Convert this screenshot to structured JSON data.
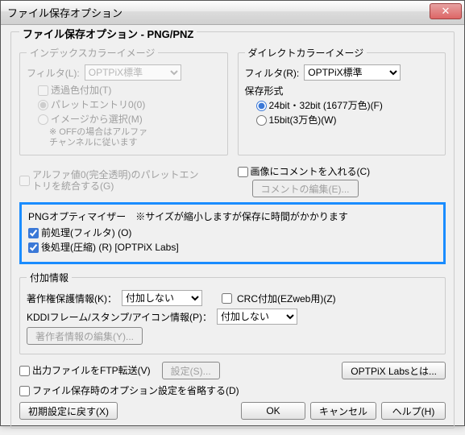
{
  "window": {
    "title": "ファイル保存オプション"
  },
  "group": {
    "title": "ファイル保存オプション - PNG/PNZ"
  },
  "indexColor": {
    "legend": "インデックスカラーイメージ",
    "filterLabel": "フィルタ(L):",
    "filterValue": "OPTPiX標準",
    "transparent": "透過色付加(T)",
    "paletteEntry0": "パレットエントリ0(0)",
    "fromImage": "イメージから選択(M)",
    "note1": "※ OFFの場合はアルファ",
    "note2": "チャンネルに従います",
    "alpha0": "アルファ値0(完全透明)のパレットエントリを統合する(G)"
  },
  "directColor": {
    "legend": "ダイレクトカラーイメージ",
    "filterLabel": "フィルタ(R):",
    "filterValue": "OPTPiX標準",
    "formatLabel": "保存形式",
    "opt24": "24bit・32bit (1677万色)(F)",
    "opt15": "15bit(3万色)(W)"
  },
  "comment": {
    "check": "画像にコメントを入れる(C)",
    "editBtn": "コメントの編集(E)..."
  },
  "optimizer": {
    "title": "PNGオプティマイザー　※サイズが縮小しますが保存に時間がかかります",
    "pre": "前処理(フィルタ) (O)",
    "post": "後処理(圧縮) (R)  [OPTPiX Labs]"
  },
  "attach": {
    "legend": "付加情報",
    "copyrightLabel": "著作権保護情報(K)：",
    "copyrightValue": "付加しない",
    "crc": "CRC付加(EZweb用)(Z)",
    "kddiLabel": "KDDIフレーム/スタンプ/アイコン情報(P)：",
    "kddiValue": "付加しない",
    "editAuthor": "著作者情報の編集(Y)..."
  },
  "bottom": {
    "ftp": "出力ファイルをFTP転送(V)",
    "ftpSettings": "設定(S)...",
    "skipOptions": "ファイル保存時のオプション設定を省略する(D)",
    "optpixLabs": "OPTPiX Labsとは..."
  },
  "footer": {
    "reset": "初期設定に戻す(X)",
    "ok": "OK",
    "cancel": "キャンセル",
    "help": "ヘルプ(H)"
  }
}
